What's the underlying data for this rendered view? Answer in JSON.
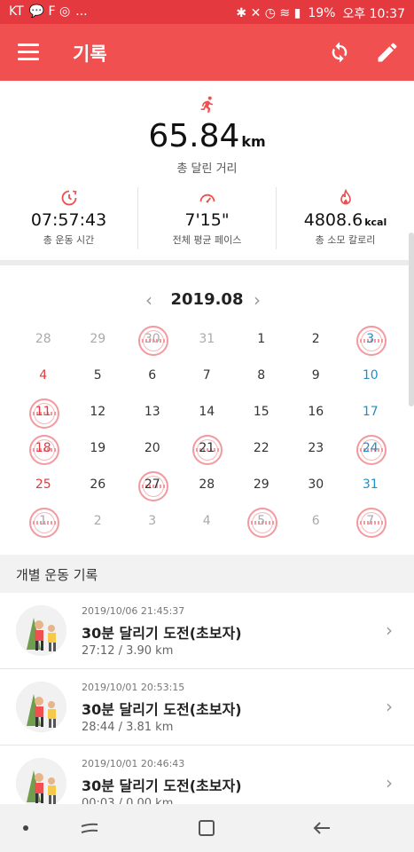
{
  "status_bar": {
    "carrier": "KT",
    "extra": "...",
    "battery": "19%",
    "time": "오후 10:37"
  },
  "app_bar": {
    "title": "기록",
    "icons": [
      "menu-icon",
      "sync-icon",
      "edit-icon"
    ],
    "color": "#f0504f"
  },
  "summary": {
    "distance_value": "65.84",
    "distance_unit": "km",
    "distance_label": "총 달린 거리",
    "stats": [
      {
        "icon": "clock-icon",
        "value": "07:57:43",
        "unit": "",
        "label": "총 운동 시간"
      },
      {
        "icon": "speedometer-icon",
        "value": "7'15\"",
        "unit": "",
        "label": "전체 평균 페이스"
      },
      {
        "icon": "flame-icon",
        "value": "4808.6",
        "unit": "kcal",
        "label": "총 소모 칼로리"
      }
    ]
  },
  "calendar": {
    "month": "2019.08",
    "weeks": [
      [
        {
          "d": "28",
          "t": "other"
        },
        {
          "d": "29",
          "t": "other"
        },
        {
          "d": "30",
          "t": "other",
          "stamp": true
        },
        {
          "d": "31",
          "t": "other"
        },
        {
          "d": "1",
          "t": ""
        },
        {
          "d": "2",
          "t": ""
        },
        {
          "d": "3",
          "t": "sat",
          "stamp": true
        }
      ],
      [
        {
          "d": "4",
          "t": "sun"
        },
        {
          "d": "5",
          "t": ""
        },
        {
          "d": "6",
          "t": ""
        },
        {
          "d": "7",
          "t": ""
        },
        {
          "d": "8",
          "t": ""
        },
        {
          "d": "9",
          "t": ""
        },
        {
          "d": "10",
          "t": "sat"
        }
      ],
      [
        {
          "d": "11",
          "t": "sun",
          "stamp": true
        },
        {
          "d": "12",
          "t": ""
        },
        {
          "d": "13",
          "t": ""
        },
        {
          "d": "14",
          "t": ""
        },
        {
          "d": "15",
          "t": ""
        },
        {
          "d": "16",
          "t": ""
        },
        {
          "d": "17",
          "t": "sat"
        }
      ],
      [
        {
          "d": "18",
          "t": "sun",
          "stamp": true
        },
        {
          "d": "19",
          "t": ""
        },
        {
          "d": "20",
          "t": ""
        },
        {
          "d": "21",
          "t": "",
          "stamp": true
        },
        {
          "d": "22",
          "t": ""
        },
        {
          "d": "23",
          "t": ""
        },
        {
          "d": "24",
          "t": "sat",
          "stamp": true
        }
      ],
      [
        {
          "d": "25",
          "t": "sun"
        },
        {
          "d": "26",
          "t": ""
        },
        {
          "d": "27",
          "t": "",
          "stamp": true
        },
        {
          "d": "28",
          "t": ""
        },
        {
          "d": "29",
          "t": ""
        },
        {
          "d": "30",
          "t": ""
        },
        {
          "d": "31",
          "t": "sat"
        }
      ],
      [
        {
          "d": "1",
          "t": "other",
          "stamp": true
        },
        {
          "d": "2",
          "t": "other"
        },
        {
          "d": "3",
          "t": "other"
        },
        {
          "d": "4",
          "t": "other"
        },
        {
          "d": "5",
          "t": "other",
          "stamp": true
        },
        {
          "d": "6",
          "t": "other"
        },
        {
          "d": "7",
          "t": "other",
          "stamp": true
        }
      ]
    ]
  },
  "records": {
    "header": "개별 운동 기록",
    "items": [
      {
        "date": "2019/10/06 21:45:37",
        "name": "30분 달리기 도전(초보자)",
        "sub": "27:12 / 3.90 km"
      },
      {
        "date": "2019/10/01 20:53:15",
        "name": "30분 달리기 도전(초보자)",
        "sub": "28:44 / 3.81 km"
      },
      {
        "date": "2019/10/01 20:46:43",
        "name": "30분 달리기 도전(초보자)",
        "sub": "00:03 / 0.00 km"
      }
    ]
  },
  "nav_bar": {
    "icons": [
      "dot-icon",
      "recent-apps-icon",
      "home-icon",
      "back-icon"
    ]
  }
}
